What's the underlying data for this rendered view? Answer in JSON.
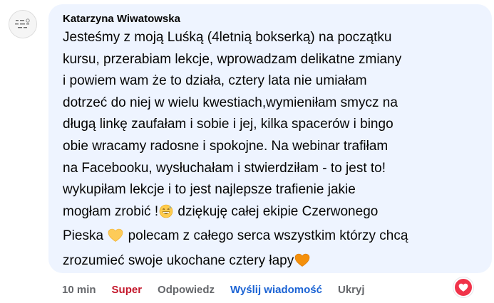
{
  "comment": {
    "author": "Katarzyna Wiwatowska",
    "lines": [
      {
        "text": "Jesteśmy z moją Luśką (4letnią bokserką) na początku"
      },
      {
        "text": "kursu, przerabiam lekcje, wprowadzam delikatne zmiany"
      },
      {
        "text": "i powiem wam że to działa, cztery lata nie umiałam"
      },
      {
        "text": "dotrzeć do niej w wielu kwestiach,wymieniłam smycz na"
      },
      {
        "text": "długą linkę zaufałam i sobie i jej, kilka spacerów i bingo"
      },
      {
        "text": "obie wracamy radosne i spokojne. Na webinar trafiłam"
      },
      {
        "text": "na Facebooku, wysłuchałam i stwierdziłam - to jest to!"
      },
      {
        "text": "wykupiłam lekcje i to jest najlepsze trafienie jakie"
      },
      {
        "a": "mogłam zrobić !",
        "b": " dziękuję całej ekipie Czerwonego"
      },
      {
        "a": "Pieska ",
        "b": " polecam z całego serca wszystkim którzy chcą"
      },
      {
        "a": "zrozumieć swoje ukochane cztery łapy"
      }
    ],
    "emojis": {
      "grin": "grinning-sweat-emoji",
      "heart_yellow": "yellow-heart-emoji",
      "heart_orange": "orange-heart-emoji"
    }
  },
  "actions": {
    "time": "10 min",
    "like": "Super",
    "reply": "Odpowiedz",
    "message": "Wyślij wiadomość",
    "hide": "Ukryj"
  },
  "colors": {
    "bubble": "#eef4ff",
    "like": "#c4182c",
    "message": "#1b63d4",
    "reaction": "#f0334a"
  },
  "reaction_icon": "heart-reaction-icon"
}
